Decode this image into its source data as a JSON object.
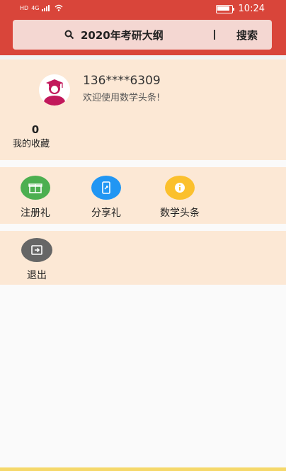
{
  "status_bar": {
    "left_badges": [
      "HD",
      "4G"
    ],
    "time": "10:24"
  },
  "search": {
    "text": "2020年考研大纲",
    "button_label": "搜索"
  },
  "profile": {
    "phone": "136****6309",
    "welcome": "欢迎使用数学头条!",
    "favorites_count": "0",
    "favorites_label": "我的收藏"
  },
  "actions": [
    {
      "label": "注册礼",
      "icon": "gift-icon",
      "color": "#4caf50"
    },
    {
      "label": "分享礼",
      "icon": "share-icon",
      "color": "#2196f3"
    },
    {
      "label": "数学头条",
      "icon": "info-icon",
      "color": "#fbc02d"
    }
  ],
  "logout": {
    "label": "退出",
    "icon": "logout-icon",
    "color": "#666666"
  },
  "colors": {
    "header": "#d9453a",
    "card": "#fce8d5"
  }
}
